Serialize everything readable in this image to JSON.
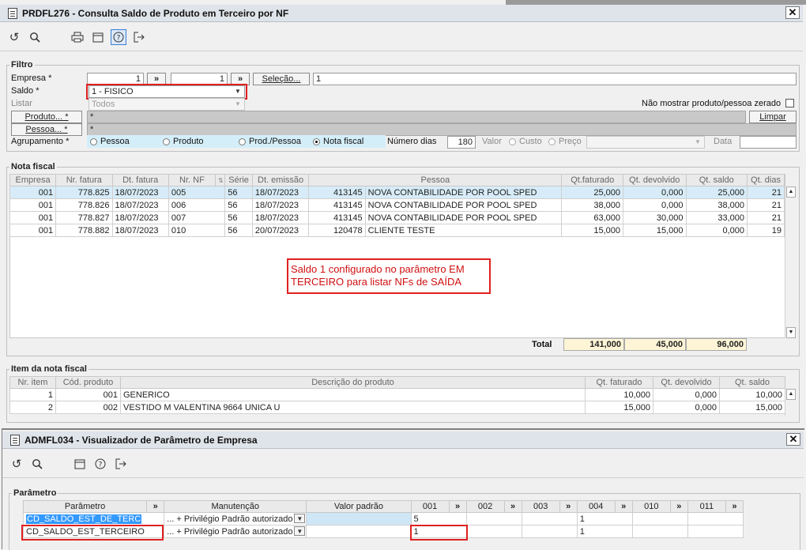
{
  "win1": {
    "title": "PRDFL276 - Consulta Saldo de Produto em Terceiro por NF",
    "close": "✕",
    "filtro": {
      "title": "Filtro",
      "empresa_label": "Empresa *",
      "empresa_from": "1",
      "empresa_to": "1",
      "arrow": "»",
      "selecao_btn": "Seleção...",
      "selecao_value": "1",
      "saldo_label": "Saldo *",
      "saldo_value": "1 - FISICO",
      "listar_label": "Listar",
      "listar_value": "Todos",
      "nao_mostrar": "Não mostrar produto/pessoa zerado",
      "produto_btn": "Produto... *",
      "produto_value": "*",
      "limpar_btn": "Limpar",
      "pessoa_btn": "Pessoa... *",
      "pessoa_value": "*",
      "agrupamento_label": "Agrupamento *",
      "agrupamento_options": [
        "Pessoa",
        "Produto",
        "Prod./Pessoa",
        "Nota fiscal"
      ],
      "agrupamento_selected": "Nota fiscal",
      "numero_dias_label": "Número dias",
      "numero_dias_value": "180",
      "valor_label": "Valor",
      "custo_label": "Custo",
      "preco_label": "Preço",
      "data_label": "Data"
    },
    "nota_fiscal": {
      "title": "Nota fiscal",
      "columns": [
        "Empresa",
        "Nr. fatura",
        "Dt. fatura",
        "Nr. NF",
        "",
        "Série",
        "Dt. emissão",
        "",
        "Pessoa",
        "Qt.faturado",
        "Qt. devolvido",
        "Qt. saldo",
        "Qt. dias"
      ],
      "rows": [
        [
          "001",
          "778.825",
          "18/07/2023",
          "005",
          "56",
          "18/07/2023",
          "413145",
          "NOVA CONTABILIDADE POR POOL SPED",
          "25,000",
          "0,000",
          "25,000",
          "21"
        ],
        [
          "001",
          "778.826",
          "18/07/2023",
          "006",
          "56",
          "18/07/2023",
          "413145",
          "NOVA CONTABILIDADE POR POOL SPED",
          "38,000",
          "0,000",
          "38,000",
          "21"
        ],
        [
          "001",
          "778.827",
          "18/07/2023",
          "007",
          "56",
          "18/07/2023",
          "413145",
          "NOVA CONTABILIDADE POR POOL SPED",
          "63,000",
          "30,000",
          "33,000",
          "21"
        ],
        [
          "001",
          "778.882",
          "18/07/2023",
          "010",
          "56",
          "20/07/2023",
          "120478",
          "CLIENTE TESTE",
          "15,000",
          "15,000",
          "0,000",
          "19"
        ]
      ],
      "note": "Saldo 1 configurado no parâmetro EM TERCEIRO para listar NFs de SAÍDA",
      "total_label": "Total",
      "total_faturado": "141,000",
      "total_devolvido": "45,000",
      "total_saldo": "96,000"
    },
    "item_nf": {
      "title": "Item da nota fiscal",
      "columns": [
        "Nr. item",
        "Cód. produto",
        "Descrição do produto",
        "Qt. faturado",
        "Qt. devolvido",
        "Qt. saldo"
      ],
      "rows": [
        [
          "1",
          "001",
          "GENERICO",
          "10,000",
          "0,000",
          "10,000"
        ],
        [
          "2",
          "002",
          "VESTIDO M VALENTINA 9664 UNICA U",
          "15,000",
          "0,000",
          "15,000"
        ]
      ]
    }
  },
  "win2": {
    "title": "ADMFL034 - Visualizador de Parâmetro de Empresa",
    "close": "✕",
    "parametro": {
      "title": "Parâmetro",
      "columns": [
        "Parâmetro",
        "Manutenção",
        "Valor padrão",
        "001",
        "002",
        "003",
        "004",
        "010",
        "011"
      ],
      "rows": [
        {
          "param": "CD_SALDO_EST_DE_TERC",
          "manut": "... + Privilégio Padrão autorizado",
          "valor": "",
          "c001": "5",
          "c002": "",
          "c003": "",
          "c004": "1",
          "c010": "",
          "c011": ""
        },
        {
          "param": "CD_SALDO_EST_TERCEIRO",
          "manut": "... + Privilégio Padrão autorizado",
          "valor": "",
          "c001": "1",
          "c002": "",
          "c003": "",
          "c004": "1",
          "c010": "",
          "c011": ""
        }
      ]
    }
  },
  "colors": {
    "highlight_red": "#e02020",
    "selected_row": "#d7ecf8",
    "total_bg": "#fdf5d6"
  }
}
